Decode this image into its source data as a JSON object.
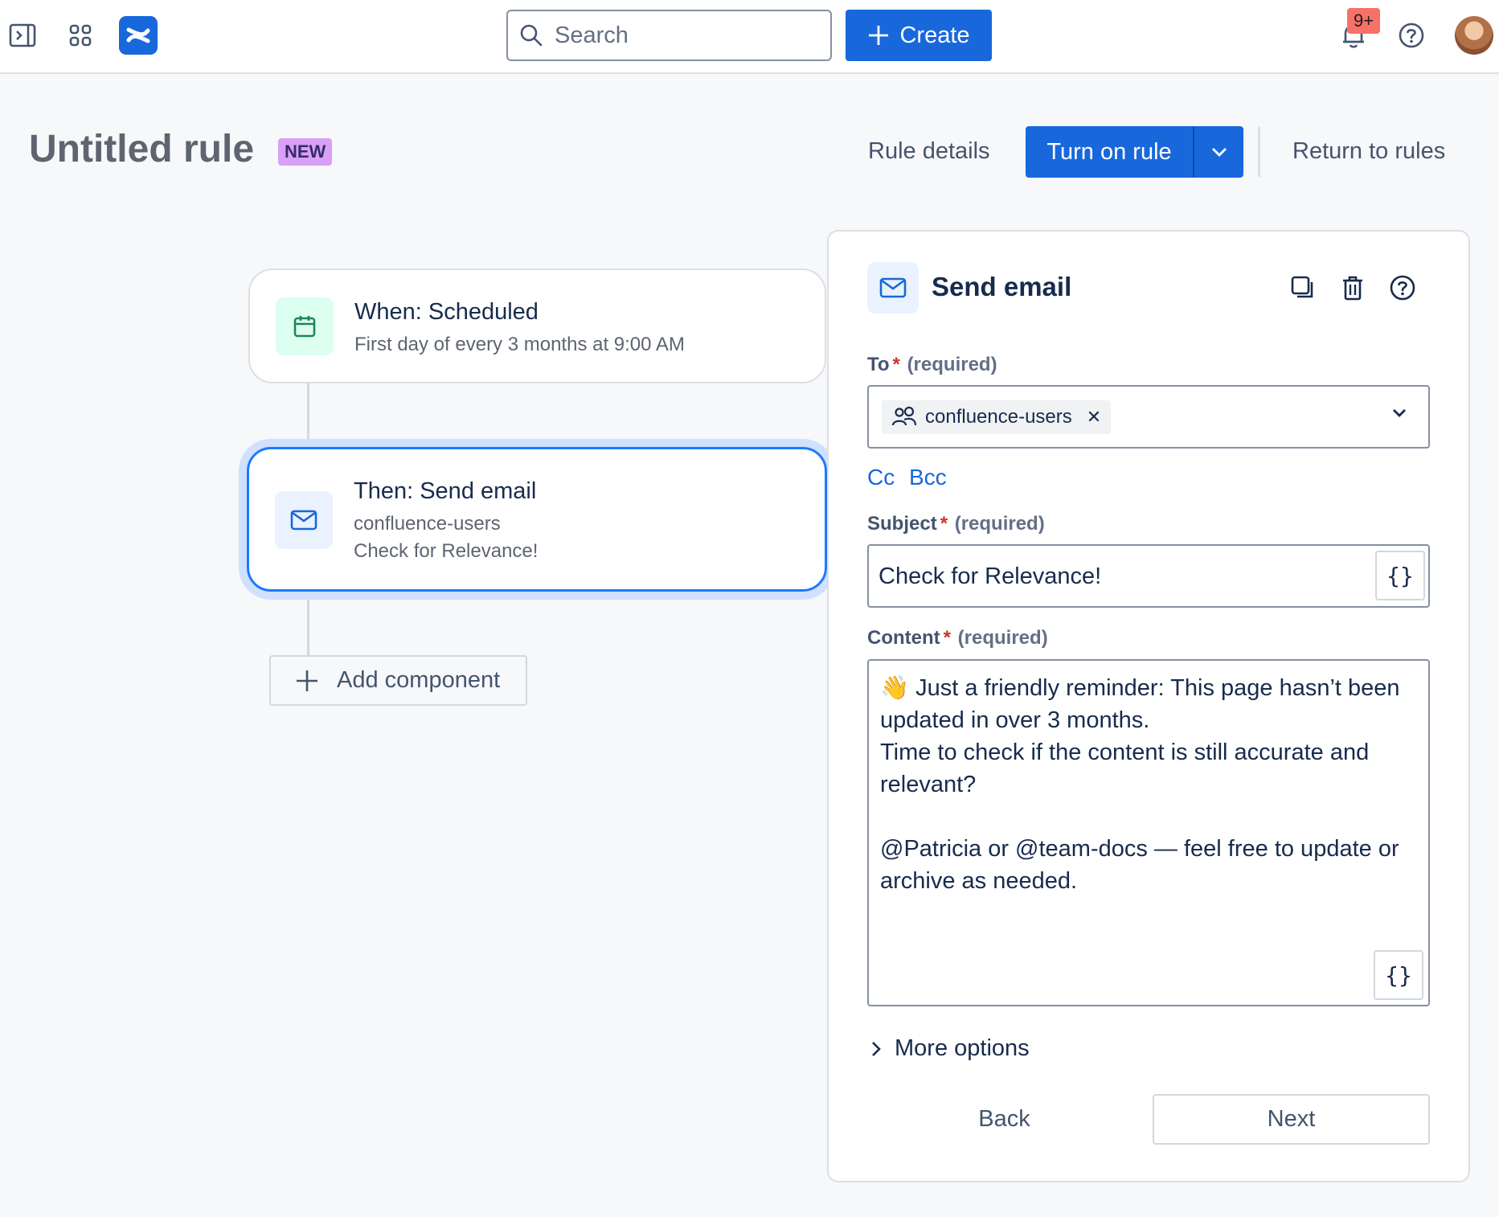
{
  "topbar": {
    "search_placeholder": "Search",
    "create_label": "Create",
    "notifications_count": "9+",
    "icons": [
      "sidebar-toggle-icon",
      "app-switcher-icon",
      "confluence-logo-icon",
      "search-icon",
      "plus-icon",
      "bell-icon",
      "help-icon"
    ]
  },
  "header": {
    "title": "Untitled rule",
    "lozenge": "NEW",
    "rule_details": "Rule details",
    "turn_on": "Turn on rule",
    "return": "Return to rules"
  },
  "flow": {
    "trigger": {
      "title": "When: Scheduled",
      "subtitle": "First day of every 3 months at 9:00 AM",
      "icon": "calendar-icon"
    },
    "action": {
      "title": "Then: Send email",
      "line1": "confluence-users",
      "line2": "Check for Relevance!",
      "icon": "mail-icon"
    },
    "add_component": "Add component"
  },
  "panel": {
    "title": "Send email",
    "to": {
      "label": "To",
      "required": "(required)",
      "tag": "confluence-users"
    },
    "cc": "Cc",
    "bcc": "Bcc",
    "subject": {
      "label": "Subject",
      "required": "(required)",
      "value": "Check for Relevance!"
    },
    "content": {
      "label": "Content",
      "required": "(required)",
      "value": "👋 Just a friendly reminder: This page hasn’t been updated in over 3 months.\nTime to check if the content is still accurate and relevant?\n\n@Patricia or @team-docs — feel free to update or archive as needed."
    },
    "more_options": "More options",
    "back": "Back",
    "next": "Next"
  },
  "colors": {
    "brand": "#1868db",
    "focus_ring": "#cfe1fd",
    "required": "#c9372c",
    "lozenge": "#d8a0f7",
    "badge": "#f87168"
  }
}
